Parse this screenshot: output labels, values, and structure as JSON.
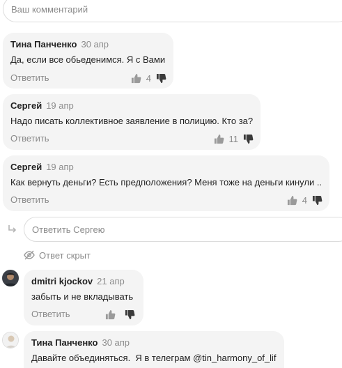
{
  "comment_input": {
    "placeholder": "Ваш комментарий"
  },
  "comments": [
    {
      "author": "Тина Панченко",
      "date": "30 апр",
      "text": "Да, если все обьеденимся. Я с Вами",
      "reply_label": "Ответить",
      "likes": "4"
    },
    {
      "author": "Сергей",
      "date": "19 апр",
      "text": "Надо писать коллективное заявление в полицию. Кто за?",
      "reply_label": "Ответить",
      "likes": "11"
    },
    {
      "author": "Сергей",
      "date": "19 апр",
      "text": "Как вернуть деньги? Есть предположения? Меня тоже на деньги кинули ..",
      "reply_label": "Ответить",
      "likes": "4"
    }
  ],
  "reply_input": {
    "placeholder": "Ответить Сергею"
  },
  "hidden_note": {
    "label": "Ответ скрыт"
  },
  "replies": [
    {
      "author": "dmitri kjockov",
      "date": "21 апр",
      "text": "забыть и не вкладывать",
      "reply_label": "Ответить"
    },
    {
      "author": "Тина Панченко",
      "date": "30 апр",
      "text": "Давайте объединяться.  Я в телеграм @tin_harmony_of_lif"
    }
  ],
  "colors": {
    "bubble": "#f4f4f4",
    "muted": "#8a8a8a",
    "border": "#dcdcdc"
  },
  "icons": [
    "thumb-up-icon",
    "thumb-down-icon",
    "reply-arrow-icon",
    "eye-off-icon"
  ]
}
